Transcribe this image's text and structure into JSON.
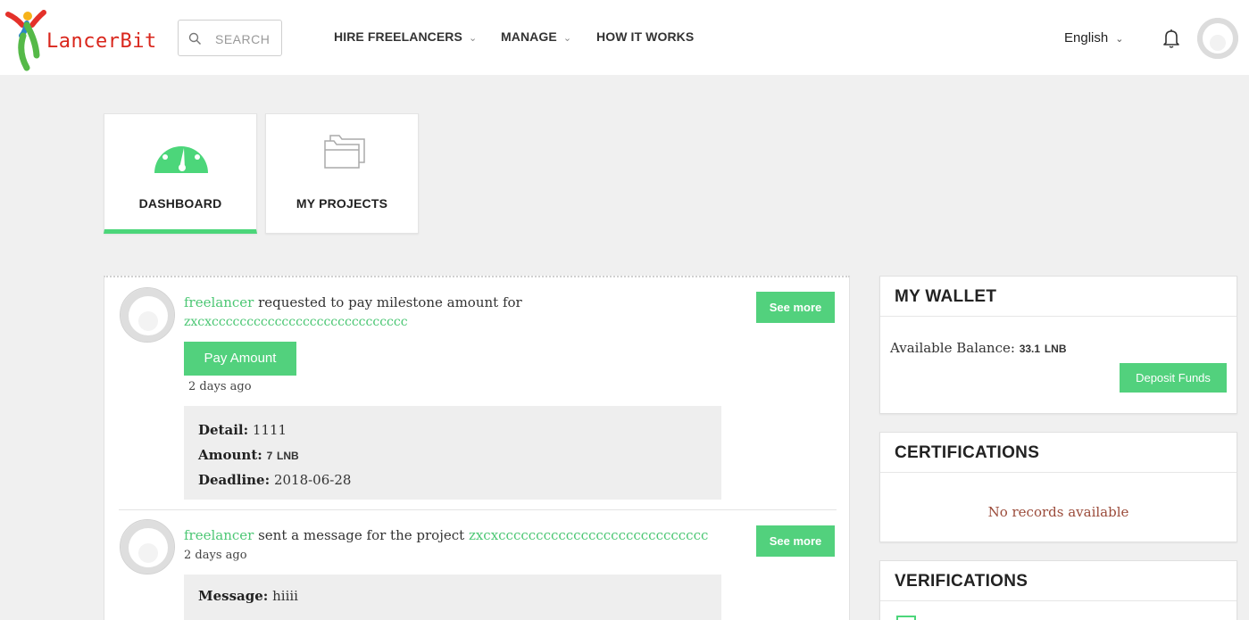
{
  "header": {
    "logo_text": "LancerBit",
    "search_placeholder": "SEARCH",
    "nav": [
      {
        "label": "HIRE FREELANCERS",
        "has_dropdown": true
      },
      {
        "label": "MANAGE",
        "has_dropdown": true
      },
      {
        "label": "HOW IT WORKS",
        "has_dropdown": false
      }
    ],
    "language": "English",
    "icons": {
      "search": "search-icon",
      "bell": "bell-icon",
      "avatar": "user-avatar",
      "chevron": "chevron-down-icon"
    }
  },
  "tabs": [
    {
      "label": "DASHBOARD",
      "icon": "speedometer-icon",
      "active": true
    },
    {
      "label": "MY PROJECTS",
      "icon": "folders-icon",
      "active": false
    }
  ],
  "activity": [
    {
      "user": "freelancer",
      "text": "requested to pay milestone amount for",
      "project": "zxcxcccccccccccccccccccccccccccc",
      "button": "Pay Amount",
      "time": "2 days ago",
      "see_more": "See more",
      "details": {
        "detail_label": "Detail:",
        "detail_value": "1111",
        "amount_label": "Amount:",
        "amount_value": "7",
        "amount_unit": "LNB",
        "deadline_label": "Deadline:",
        "deadline_value": "2018-06-28"
      }
    },
    {
      "user": "freelancer",
      "text": "sent a message for the project",
      "project": "zxcxcccccccccccccccccccccccccccc",
      "time": "2 days ago",
      "see_more": "See more",
      "message_label": "Message:",
      "message_value": "hiiii"
    }
  ],
  "wallet": {
    "title": "MY WALLET",
    "balance_label": "Available Balance:",
    "balance_value": "33.1",
    "balance_unit": "LNB",
    "deposit_button": "Deposit Funds"
  },
  "certifications": {
    "title": "CERTIFICATIONS",
    "empty_text": "No records available"
  },
  "verifications": {
    "title": "VERIFICATIONS"
  },
  "colors": {
    "accent_green": "#52d17d",
    "link_green": "#4cc774",
    "logo_red": "#d9261c",
    "empty_text": "#9b4b3a"
  }
}
